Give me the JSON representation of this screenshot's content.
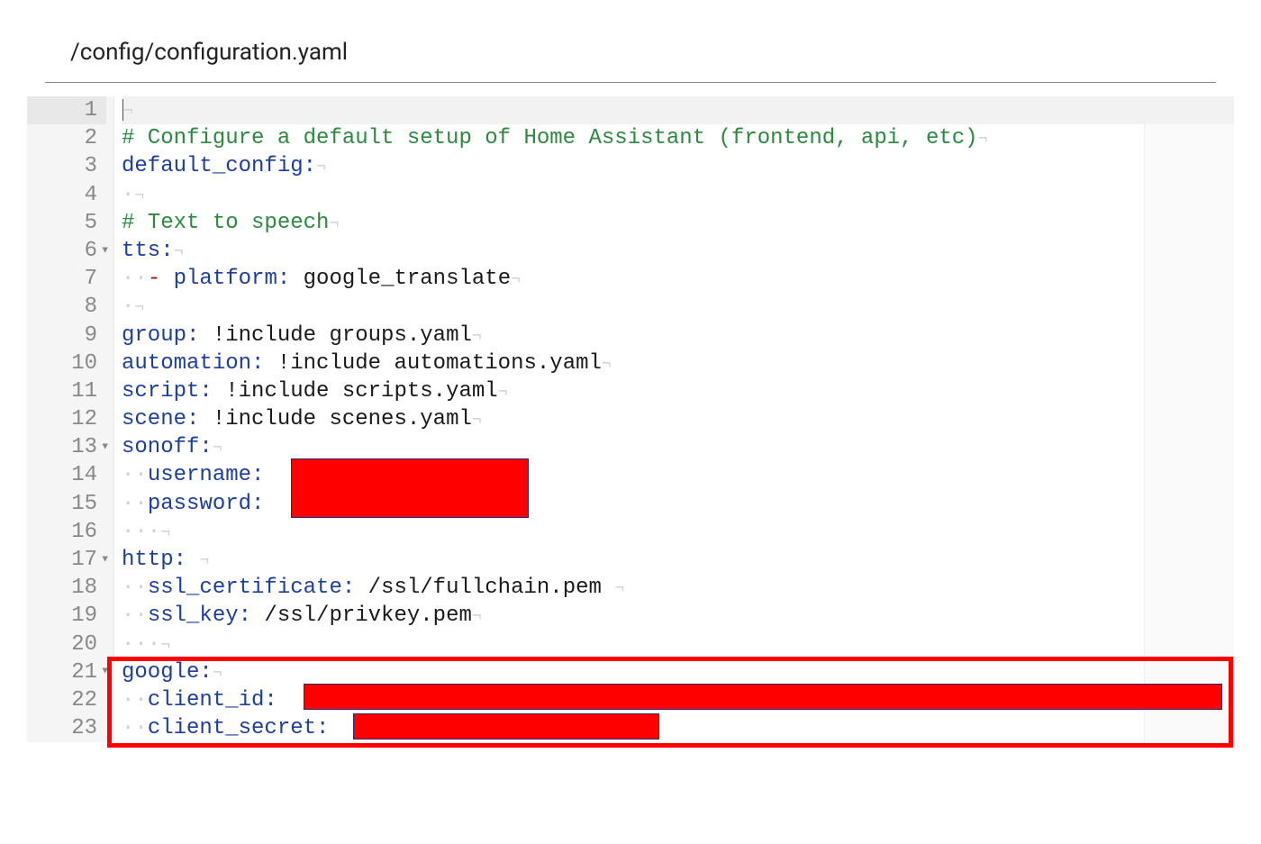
{
  "header": {
    "path": "/config/configuration.yaml"
  },
  "lines": {
    "n1": "1",
    "n2": "2",
    "n3": "3",
    "n4": "4",
    "n5": "5",
    "n6": "6",
    "n7": "7",
    "n8": "8",
    "n9": "9",
    "n10": "10",
    "n11": "11",
    "n12": "12",
    "n13": "13",
    "n14": "14",
    "n15": "15",
    "n16": "16",
    "n17": "17",
    "n18": "18",
    "n19": "19",
    "n20": "20",
    "n21": "21",
    "n22": "22",
    "n23": "23"
  },
  "code": {
    "comment1": "# Configure a default setup of Home Assistant (frontend, api, etc)",
    "default_config": "default_config:",
    "comment2": "# Text to speech",
    "tts": "tts:",
    "platform_key": "platform:",
    "platform_val": " google_translate",
    "group_key": "group:",
    "group_val": " !include groups.yaml",
    "automation_key": "automation:",
    "automation_val": " !include automations.yaml",
    "script_key": "script:",
    "script_val": " !include scripts.yaml",
    "scene_key": "scene:",
    "scene_val": " !include scenes.yaml",
    "sonoff": "sonoff:",
    "username": "username:",
    "password": "password:",
    "http": "http:",
    "ssl_cert_key": "ssl_certificate:",
    "ssl_cert_val": " /ssl/fullchain.pem",
    "ssl_key_key": "ssl_key:",
    "ssl_key_val": " /ssl/privkey.pem",
    "google": "google:",
    "client_id": "client_id:",
    "client_secret": "client_secret:"
  },
  "ws": {
    "dot": "·",
    "dash": "- ",
    "eol": "¬",
    "two": "··",
    "three": "···"
  }
}
